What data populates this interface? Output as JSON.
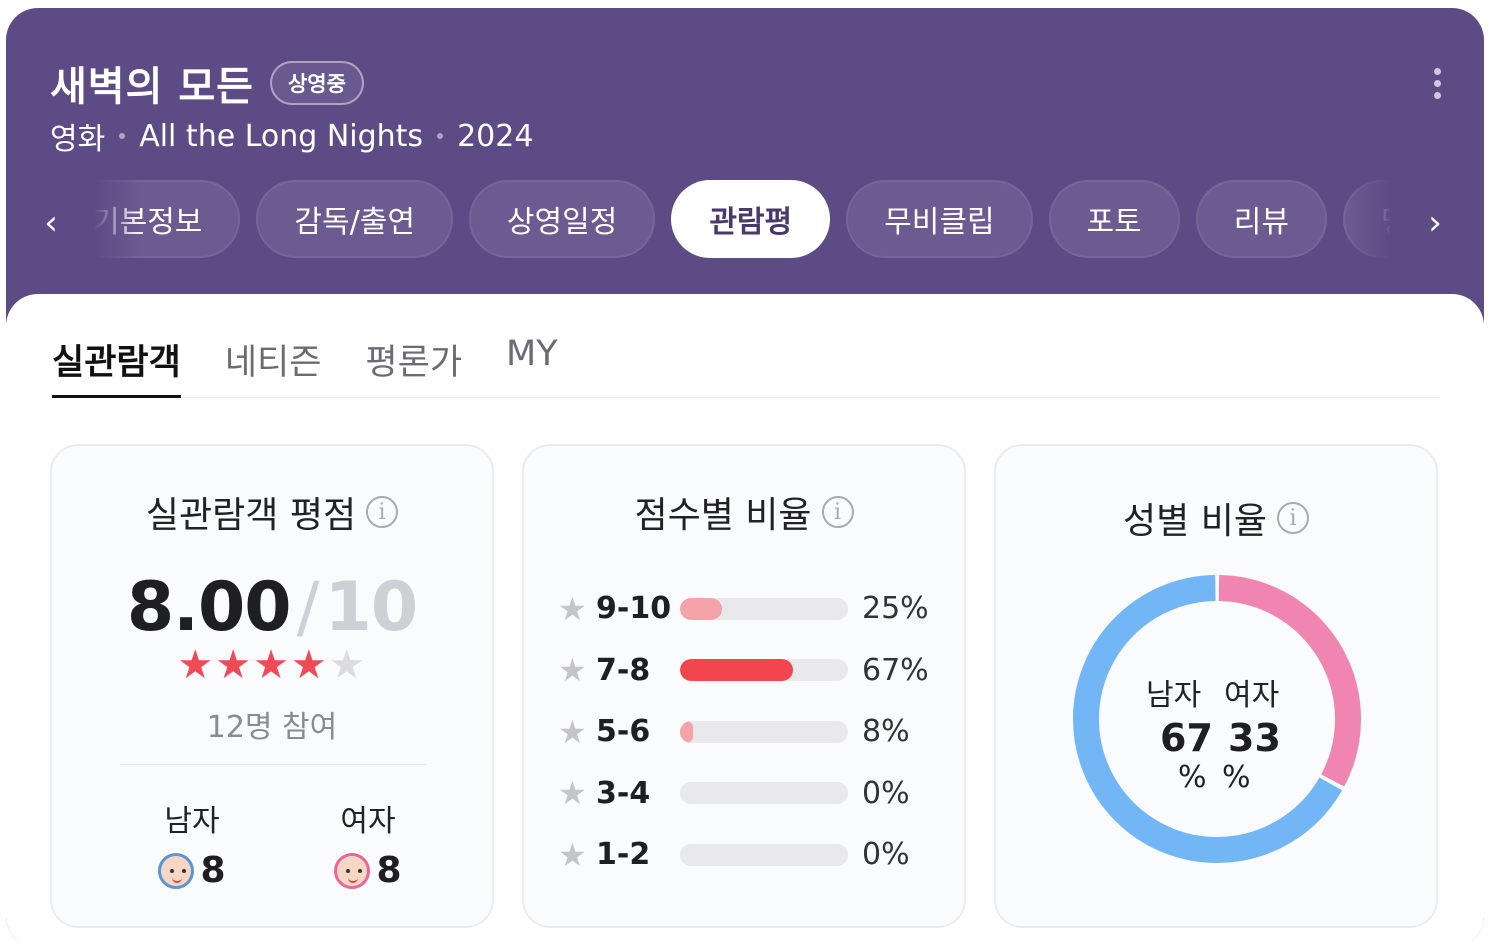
{
  "header": {
    "title": "새벽의 모든",
    "badge": "상영중",
    "category": "영화",
    "english_title": "All the Long Nights",
    "year": "2024"
  },
  "nav_tabs": [
    {
      "label": "기본정보"
    },
    {
      "label": "감독/출연"
    },
    {
      "label": "상영일정"
    },
    {
      "label": "관람평",
      "active": true
    },
    {
      "label": "무비클립"
    },
    {
      "label": "포토"
    },
    {
      "label": "리뷰"
    },
    {
      "label": "명대사"
    }
  ],
  "sub_tabs": [
    {
      "label": "실관람객",
      "active": true
    },
    {
      "label": "네티즌"
    },
    {
      "label": "평론가"
    },
    {
      "label": "MY"
    }
  ],
  "rating": {
    "title": "실관람객 평점",
    "score": "8.00",
    "slash": "/",
    "max": "10",
    "stars_filled": 4,
    "stars_total": 5,
    "participants": "12명 참여",
    "male_label": "남자",
    "male_score": "8",
    "female_label": "여자",
    "female_score": "8"
  },
  "distribution": {
    "title": "점수별 비율",
    "rows": [
      {
        "range": "9-10",
        "percent": 25,
        "label": "25%",
        "color": "#f4a3a8"
      },
      {
        "range": "7-8",
        "percent": 67,
        "label": "67%",
        "color": "#f2464e"
      },
      {
        "range": "5-6",
        "percent": 8,
        "label": "8%",
        "color": "#f4a3a8"
      },
      {
        "range": "3-4",
        "percent": 0,
        "label": "0%",
        "color": "#f4a3a8"
      },
      {
        "range": "1-2",
        "percent": 0,
        "label": "0%",
        "color": "#f4a3a8"
      }
    ]
  },
  "gender_ratio": {
    "title": "성별 비율",
    "male_label": "남자",
    "male_value": "67",
    "male_unit": "%",
    "female_label": "여자",
    "female_value": "33",
    "female_unit": "%",
    "male_percent": 67,
    "female_percent": 33,
    "male_color": "#72b6f5",
    "female_color": "#f085b1"
  },
  "colors": {
    "header_bg": "#5d4b86",
    "star_on": "#ef4a56"
  }
}
